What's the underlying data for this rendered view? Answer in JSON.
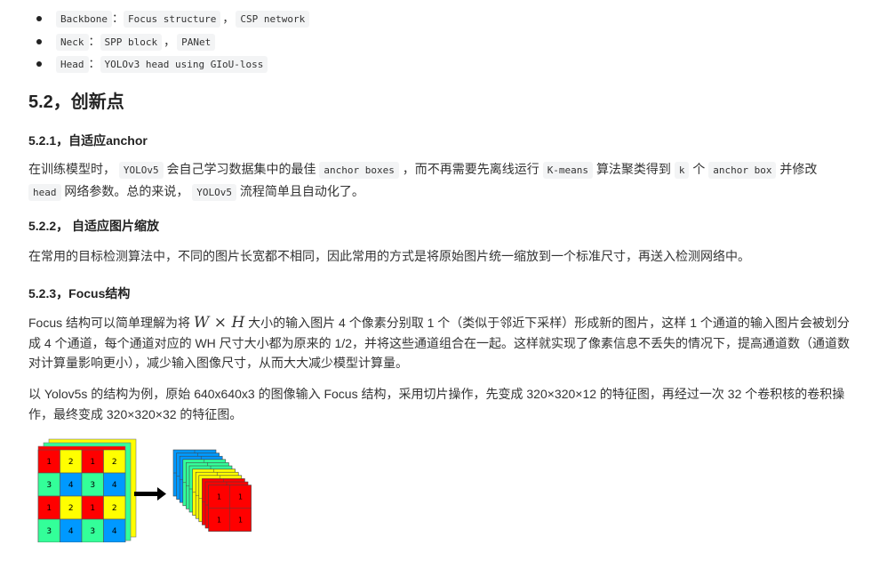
{
  "bullets": [
    {
      "label": "Backbone",
      "colon": "：",
      "items": [
        "Focus structure",
        "CSP network"
      ],
      "sep": "，"
    },
    {
      "label": "Neck",
      "colon": "：",
      "items": [
        "SPP block",
        "PANet"
      ],
      "sep": "，"
    },
    {
      "label": "Head",
      "colon": "：",
      "items": [
        "YOLOv3 head using GIoU-loss"
      ],
      "sep": ""
    }
  ],
  "section": {
    "title": "5.2，创新点"
  },
  "s1": {
    "title": "5.2.1，自适应anchor",
    "t1": "在训练模型时，",
    "c1": "YOLOv5",
    "t2": "会自己学习数据集中的最佳",
    "c2": "anchor boxes",
    "t3": "，而不再需要先离线运行",
    "c3": "K-means",
    "t4": "算法聚类得到",
    "c4": "k",
    "t5": "个",
    "c5": "anchor box",
    "t6": "并修改",
    "c6": "head",
    "t7": "网络参数。总的来说，",
    "c7": "YOLOv5",
    "t8": "流程简单且自动化了。"
  },
  "s2": {
    "title": "5.2.2， 自适应图片缩放",
    "text": "在常用的目标检测算法中，不同的图片长宽都不相同，因此常用的方式是将原始图片统一缩放到一个标准尺寸，再送入检测网络中。"
  },
  "s3": {
    "title": "5.2.3，Focus结构",
    "p1a": "Focus 结构可以简单理解为将",
    "math_w": "W",
    "math_x": "×",
    "math_h": "H",
    "p1b": "大小的输入图片 4 个像素分别取 1 个（类似于邻近下采样）形成新的图片，这样 1 个通道的输入图片会被划分成 4 个通道，每个通道对应的 WH 尺寸大小都为原来的 1/2，并将这些通道组合在一起。这样就实现了像素信息不丢失的情况下，提高通道数（通道数对计算量影响更小），减少输入图像尺寸，从而大大减少模型计算量。",
    "p2": "以 Yolov5s 的结构为例，原始 640x640x3 的图像输入 Focus 结构，采用切片操作，先变成 320×320×12 的特征图，再经过一次 32 个卷积核的卷积操作，最终变成 320×320×32 的特征图。"
  },
  "figure": {
    "left_grid": [
      [
        "1",
        "2",
        "1",
        "2"
      ],
      [
        "3",
        "4",
        "3",
        "4"
      ],
      [
        "1",
        "2",
        "1",
        "2"
      ],
      [
        "3",
        "4",
        "3",
        "4"
      ]
    ],
    "front_slice": [
      [
        "1",
        "1"
      ],
      [
        "1",
        "1"
      ]
    ],
    "colors": {
      "red": "#ff0000",
      "yellow": "#ffff00",
      "green": "#33ff99",
      "blue": "#0099ff",
      "arrow": "#000000"
    }
  }
}
